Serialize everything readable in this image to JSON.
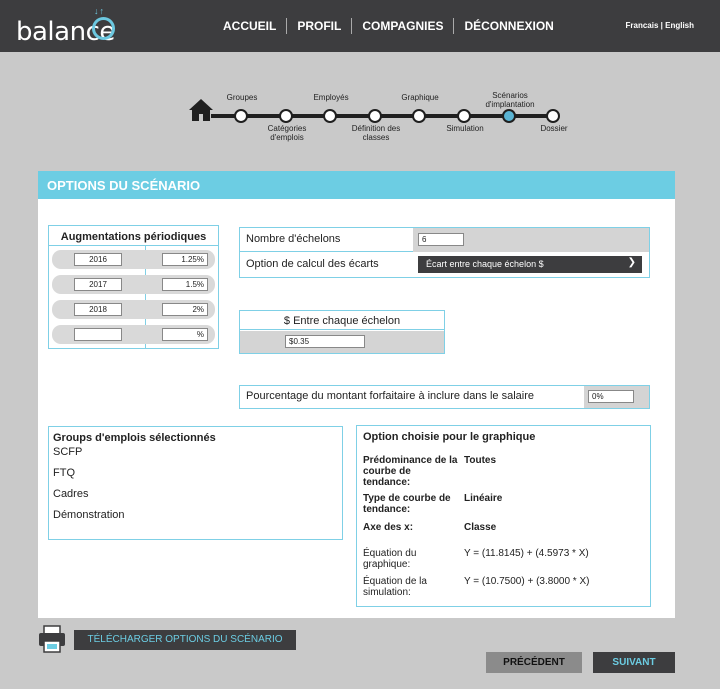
{
  "header": {
    "logo_text": "balance",
    "nav": [
      "ACCUEIL",
      "PROFIL",
      "COMPAGNIES",
      "DÉCONNEXION"
    ],
    "lang_fr": "Francais",
    "lang_sep": " | ",
    "lang_en": "English"
  },
  "progress": {
    "steps": [
      {
        "label": "Groupes"
      },
      {
        "label": "Catégories d'emplois"
      },
      {
        "label": "Employés"
      },
      {
        "label": "Définition des classes"
      },
      {
        "label": "Graphique"
      },
      {
        "label": "Simulation"
      },
      {
        "label": "Scénarios d'implantation"
      },
      {
        "label": "Dossier"
      }
    ],
    "active_step": "Scénarios d'implantation"
  },
  "panel": {
    "title": "OPTIONS DU SCÉNARIO",
    "augmentations": {
      "title": "Augmentations périodiques",
      "rows": [
        {
          "year": "2016",
          "pct": "1.25%"
        },
        {
          "year": "2017",
          "pct": "1.5%"
        },
        {
          "year": "2018",
          "pct": "2%"
        },
        {
          "year": "",
          "pct": "%"
        }
      ]
    },
    "nombre_echelons": {
      "label": "Nombre d'échelons",
      "value": "6"
    },
    "option_calcul": {
      "label": "Option de calcul des écarts",
      "value": "Écart entre chaque échelon $"
    },
    "entre_echelon": {
      "label": "$ Entre chaque échelon",
      "value": "$0.35"
    },
    "forfaitaire": {
      "label": "Pourcentage du montant forfaitaire à inclure dans le salaire",
      "value": "0%"
    },
    "groups": {
      "title": "Groups d'emplois sélectionnés",
      "items": [
        "SCFP",
        "FTQ",
        "Cadres",
        "Démonstration"
      ]
    },
    "graph_option": {
      "title": "Option choisie pour le graphique",
      "predominance_label": "Prédominance de la courbe de tendance:",
      "predominance_value": "Toutes",
      "type_label": "Type de courbe de tendance:",
      "type_value": "Linéaire",
      "axe_label": "Axe des x:",
      "axe_value": "Classe",
      "eq_graph_label": "Équation du graphique:",
      "eq_graph_value": "Y = (11.8145) + (4.5973 * X)",
      "eq_sim_label": "Équation de la simulation:",
      "eq_sim_value": "Y = (10.7500) + (3.8000 * X)"
    }
  },
  "buttons": {
    "download": "TÉLÉCHARGER OPTIONS DU SCÉNARIO",
    "previous": "PRÉCÉDENT",
    "next": "SUIVANT"
  },
  "colors": {
    "accent": "#6ccde3",
    "header_bg": "#3d3d3f",
    "page_bg": "#c9c9c9"
  }
}
